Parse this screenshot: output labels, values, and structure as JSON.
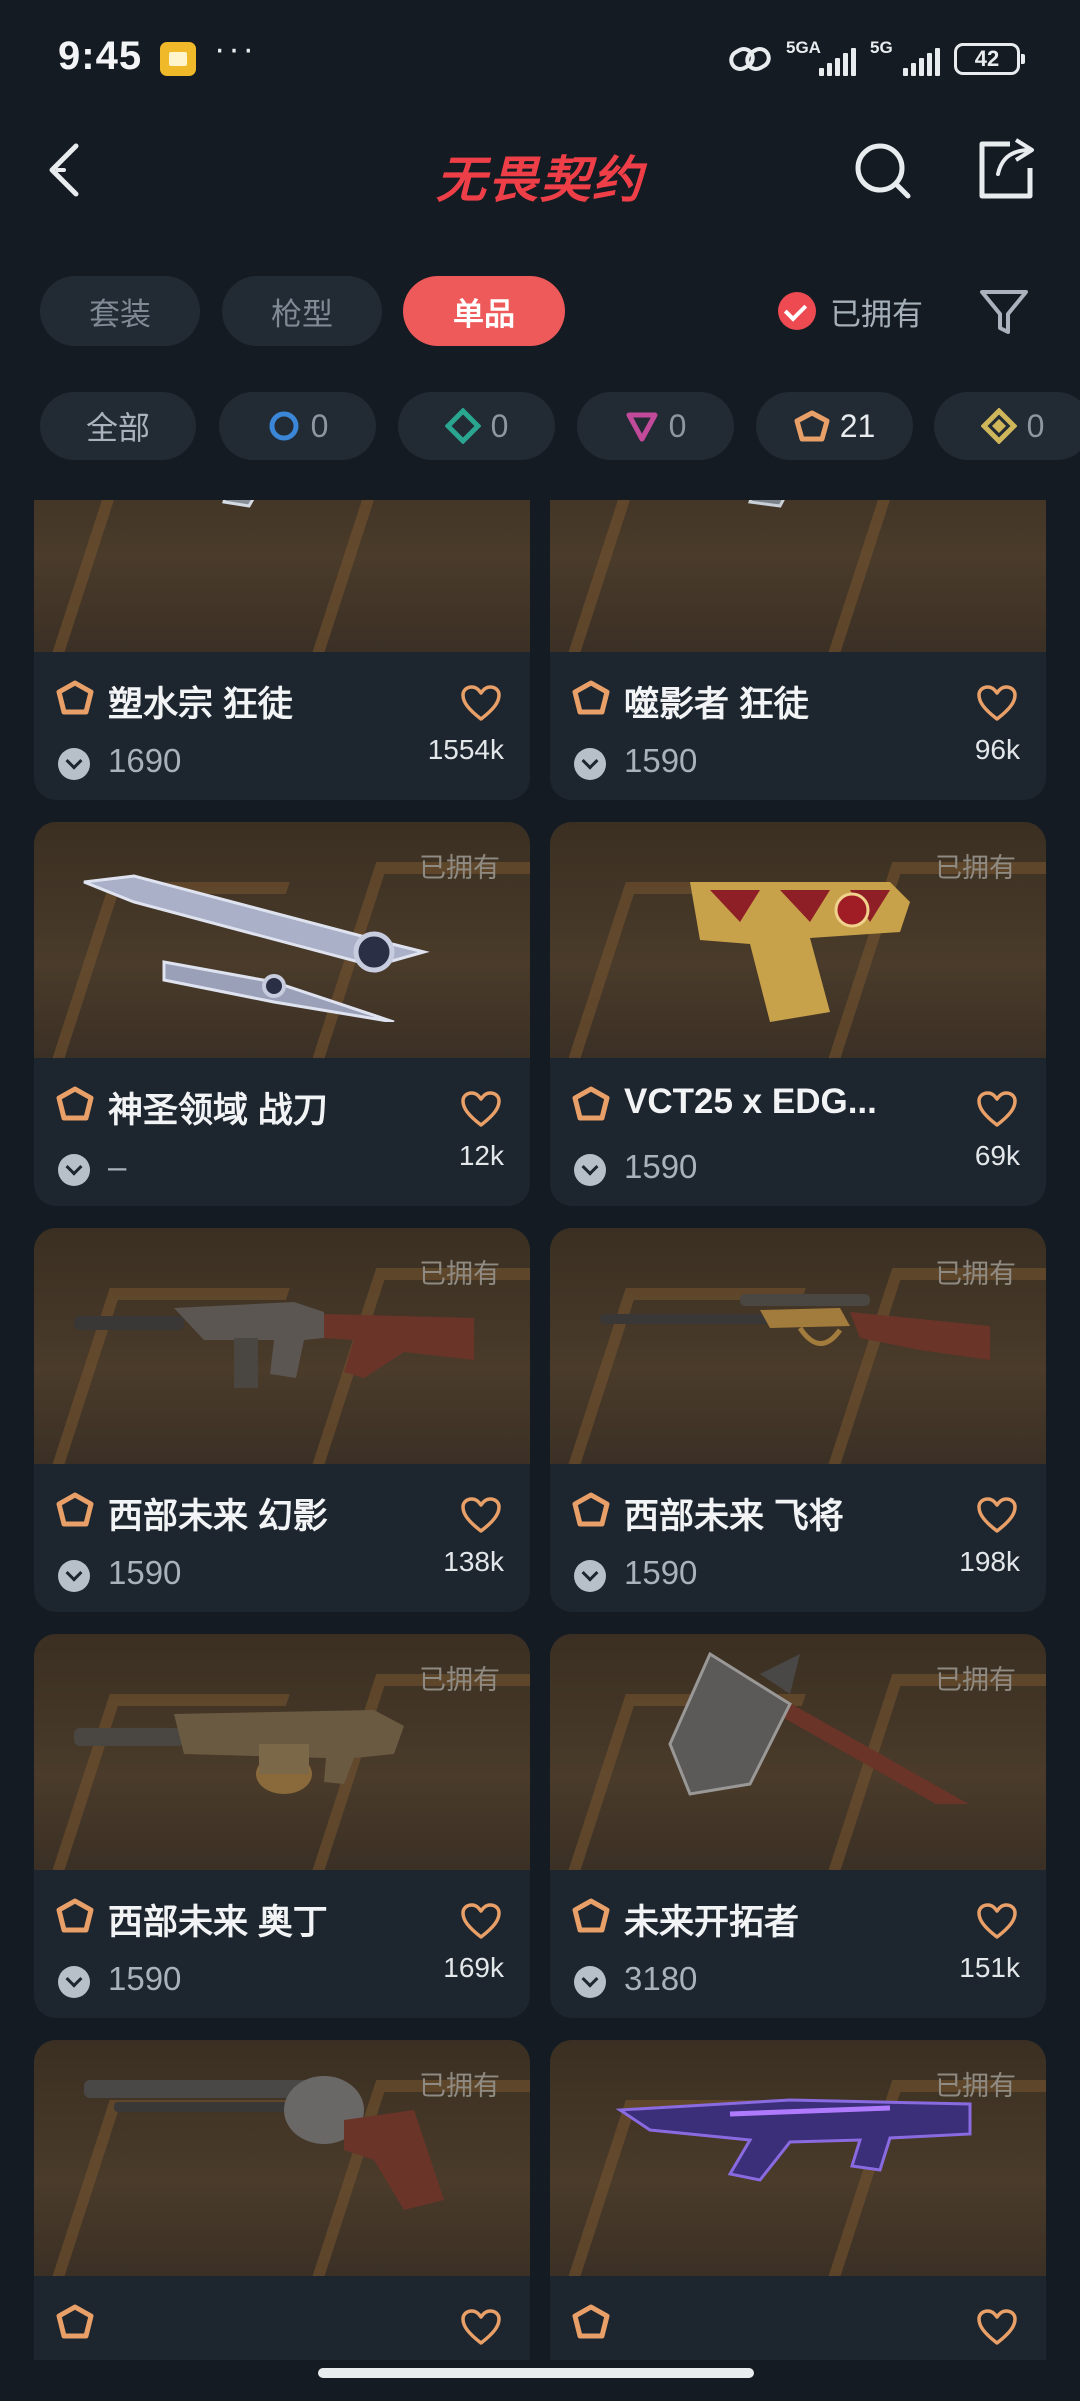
{
  "status_bar": {
    "time": "9:45",
    "dots": "···",
    "network_1": "5GA",
    "network_2": "5G",
    "battery": "42"
  },
  "header": {
    "title": "无畏契约"
  },
  "tabs": [
    {
      "label": "套装",
      "active": false
    },
    {
      "label": "枪型",
      "active": false
    },
    {
      "label": "单品",
      "active": true
    }
  ],
  "owned_filter": {
    "label": "已拥有",
    "checked": true
  },
  "tier_filters": [
    {
      "label": "全部",
      "count": ""
    },
    {
      "label": "",
      "count": "0",
      "color": "#3b86d6",
      "shape": "circle"
    },
    {
      "label": "",
      "count": "0",
      "color": "#2aa58f",
      "shape": "diamond"
    },
    {
      "label": "",
      "count": "0",
      "color": "#c24a9a",
      "shape": "triangle"
    },
    {
      "label": "",
      "count": "21",
      "color": "#e8a068",
      "shape": "pentagon"
    },
    {
      "label": "",
      "count": "0",
      "color": "#d0b65a",
      "shape": "diamond"
    }
  ],
  "colors": {
    "accent": "#ee5a5a",
    "tier_exclusive": "#e8a068",
    "background": "#151b22",
    "card": "#1d252e"
  },
  "cards": [
    {
      "name": "塑水宗 狂徒",
      "price": "1690",
      "likes": "1554k",
      "owned_label": "",
      "weapon": "rifle-blue"
    },
    {
      "name": "噬影者 狂徒",
      "price": "1590",
      "likes": "96k",
      "owned_label": "",
      "weapon": "rifle-silver"
    },
    {
      "name": "神圣领域 战刀",
      "price": "–",
      "likes": "12k",
      "owned_label": "已拥有",
      "weapon": "blade"
    },
    {
      "name": "VCT25 x EDG...",
      "price": "1590",
      "likes": "69k",
      "owned_label": "已拥有",
      "weapon": "pistol-edg"
    },
    {
      "name": "西部未来 幻影",
      "price": "1590",
      "likes": "138k",
      "owned_label": "已拥有",
      "weapon": "rifle-wood"
    },
    {
      "name": "西部未来 飞将",
      "price": "1590",
      "likes": "198k",
      "owned_label": "已拥有",
      "weapon": "sniper-wood"
    },
    {
      "name": "西部未来 奥丁",
      "price": "1590",
      "likes": "169k",
      "owned_label": "已拥有",
      "weapon": "lmg"
    },
    {
      "name": "未来开拓者",
      "price": "3180",
      "likes": "151k",
      "owned_label": "已拥有",
      "weapon": "axe"
    },
    {
      "name": "",
      "price": "",
      "likes": "",
      "owned_label": "已拥有",
      "weapon": "revolver"
    },
    {
      "name": "",
      "price": "",
      "likes": "",
      "owned_label": "已拥有",
      "weapon": "smg-purple"
    }
  ]
}
